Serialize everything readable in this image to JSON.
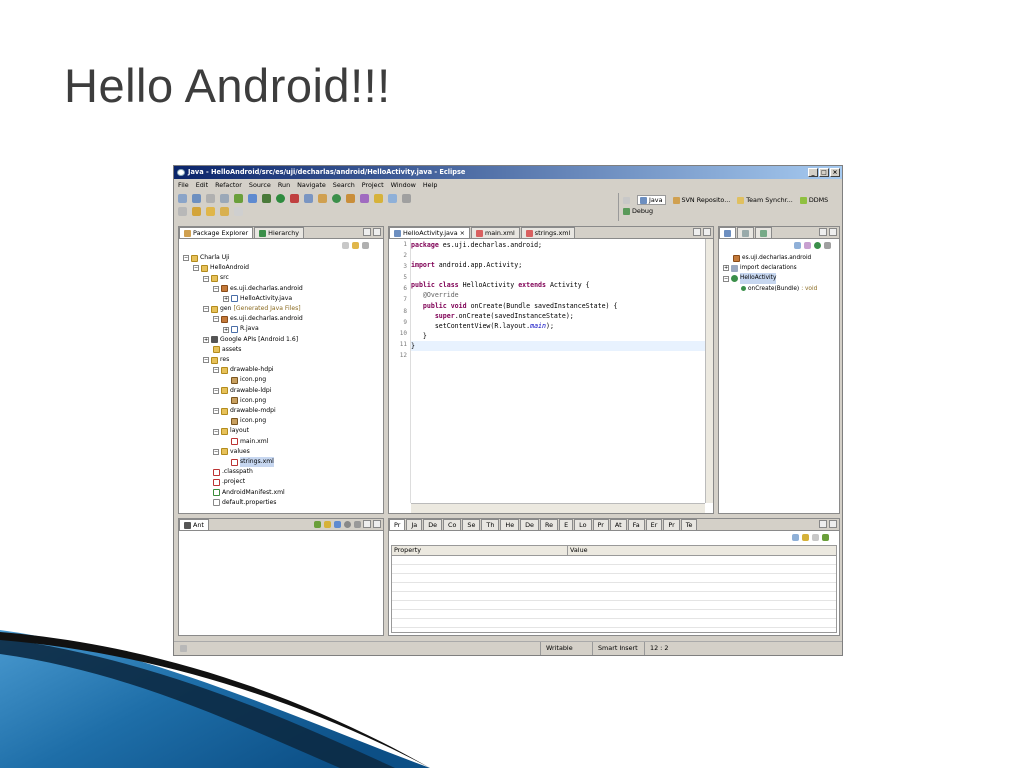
{
  "slide": {
    "title": "Hello Android!!!"
  },
  "window": {
    "title": "Java - HelloAndroid/src/es/uji/decharlas/android/HelloActivity.java - Eclipse",
    "min_label": "_",
    "max_label": "□",
    "close_label": "×"
  },
  "menu": [
    "File",
    "Edit",
    "Refactor",
    "Source",
    "Run",
    "Navigate",
    "Search",
    "Project",
    "Window",
    "Help"
  ],
  "perspectives": [
    "Java",
    "SVN Reposito...",
    "Team Synchr...",
    "DDMS",
    "Debug"
  ],
  "package_explorer": {
    "tab_label": "Package Explorer",
    "hierarchy_label": "Hierarchy",
    "tree": {
      "charla": "Charla Uji",
      "project": "HelloAndroid",
      "src": "src",
      "src_pkg": "es.uji.decharlas.android",
      "activity": "HelloActivity.java",
      "gen": "gen",
      "gen_tag": "[Generated Java Files]",
      "gen_pkg": "es.uji.decharlas.android",
      "rjava": "R.java",
      "google": "Google APIs [Android 1.6]",
      "assets": "assets",
      "res": "res",
      "hdpi": "drawable-hdpi",
      "hdpi_icon": "icon.png",
      "ldpi": "drawable-ldpi",
      "ldpi_icon": "icon.png",
      "mdpi": "drawable-mdpi",
      "mdpi_icon": "icon.png",
      "layout": "layout",
      "main_xml": "main.xml",
      "values": "values",
      "strings_xml": "strings.xml",
      "classpath": ".classpath",
      "project_file": ".project",
      "manifest": "AndroidManifest.xml",
      "defprops": "default.properties"
    }
  },
  "editor": {
    "tabs": [
      "HelloActivity.java",
      "main.xml",
      "strings.xml"
    ],
    "line_numbers": [
      "1",
      "2",
      "3",
      "5",
      "6",
      "7",
      "8",
      "9",
      "10",
      "11",
      "12"
    ],
    "code": {
      "l1_kw": "package",
      "l1_rest": " es.uji.decharlas.android;",
      "l3_kw": "import",
      "l3_rest": " android.app.Activity;",
      "l6_kw1": "public class",
      "l6_mid": " HelloActivity ",
      "l6_kw2": "extends",
      "l6_rest": " Activity {",
      "l7_an": "@Override",
      "l8_kw": "public void",
      "l8_rest": " onCreate(Bundle savedInstanceState) {",
      "l9_kw": "super",
      "l9_rest": ".onCreate(savedInstanceState);",
      "l10_pre": "setContentView(R.layout.",
      "l10_fi": "main",
      "l10_post": ");",
      "l11": "}",
      "l12": "}"
    }
  },
  "outline": {
    "tree": {
      "pkg": "es.uji.decharlas.android",
      "imports": "import declarations",
      "cls": "HelloActivity",
      "method": "onCreate(Bundle)",
      "method_type": ": void"
    }
  },
  "ant": {
    "tab_label": "Ant"
  },
  "bottom_tabs": [
    "Pr",
    "Ja",
    "De",
    "Co",
    "Se",
    "Th",
    "He",
    "De",
    "Re",
    "E",
    "Lo",
    "Pr",
    "At",
    "Fa",
    "Er",
    "Pr",
    "Te"
  ],
  "properties": {
    "col_property": "Property",
    "col_value": "Value"
  },
  "status": {
    "writable": "Writable",
    "insert": "Smart Insert",
    "position": "12 : 2"
  },
  "colors": {
    "keyword": "#7f0055",
    "annotation": "#646464",
    "field": "#0000c0",
    "title_bar": "#0a246a"
  }
}
